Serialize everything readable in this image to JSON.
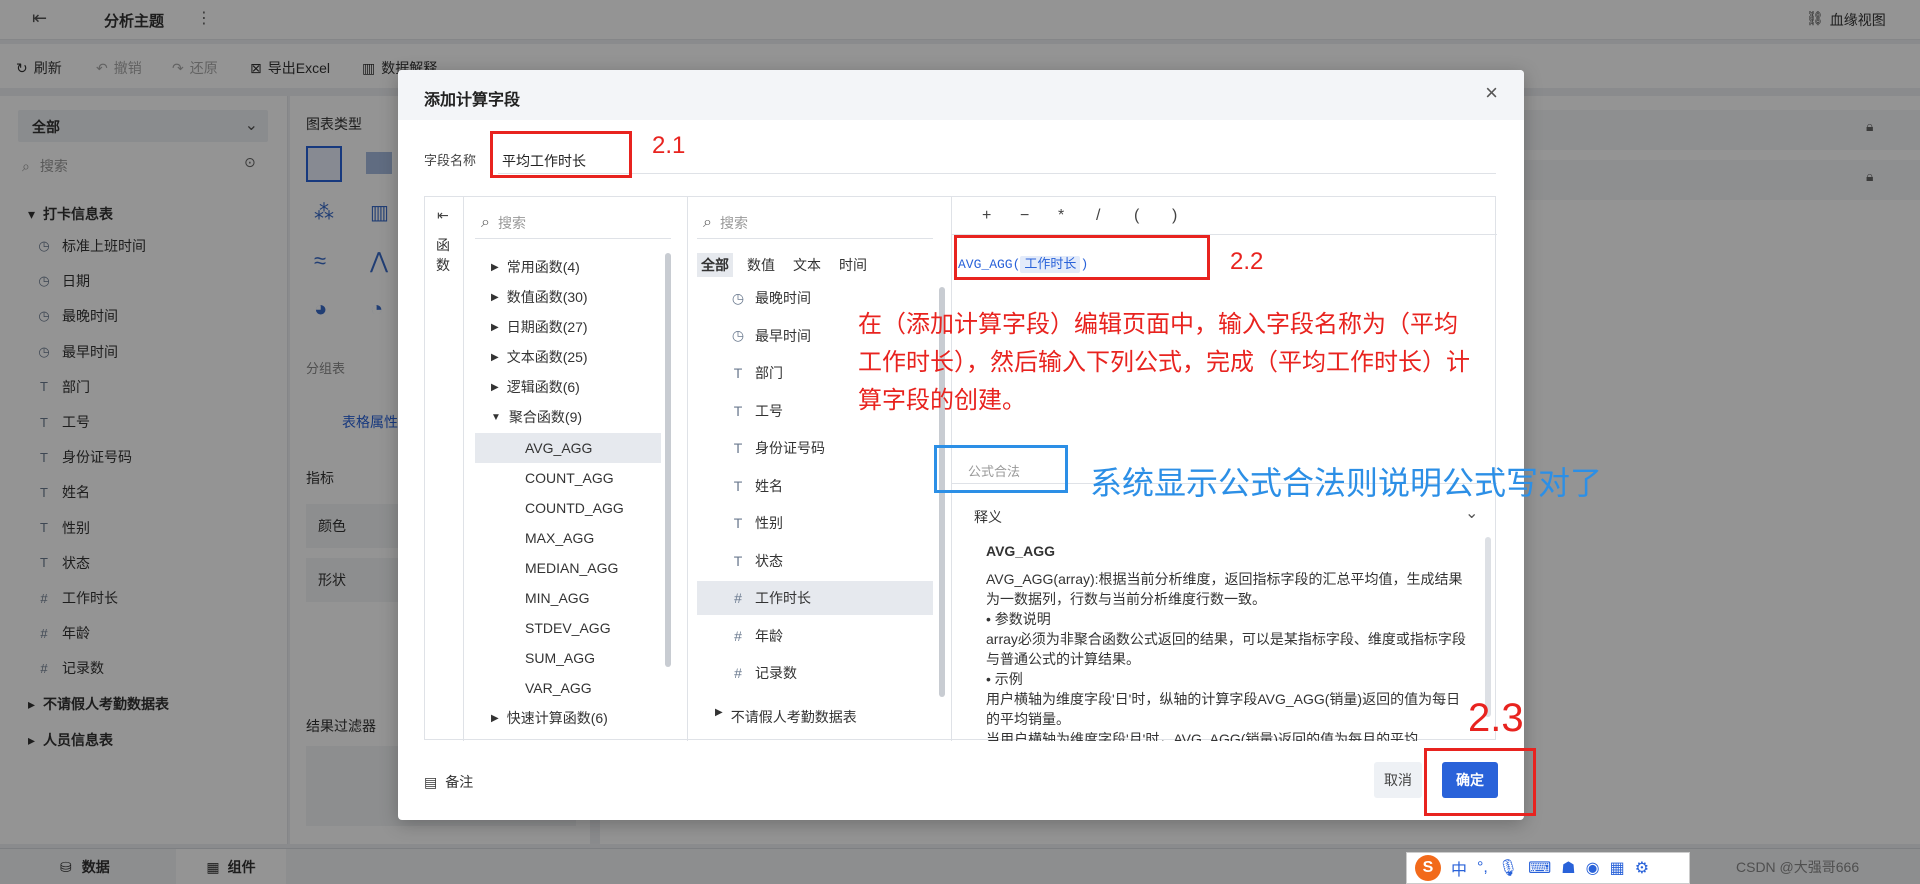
{
  "app": {
    "title": "分析主题",
    "lineage_label": "血缘视图",
    "toolbar": [
      {
        "label": "刷新",
        "disabled": false
      },
      {
        "label": "撤销",
        "disabled": true
      },
      {
        "label": "还原",
        "disabled": true
      },
      {
        "label": "导出Excel",
        "disabled": false
      },
      {
        "label": "数据解释",
        "disabled": false
      }
    ],
    "left": {
      "select_value": "全部",
      "search_placeholder": "搜索",
      "table1": "打卡信息表",
      "fields": [
        {
          "icon": "clock",
          "name": "标准上班时间"
        },
        {
          "icon": "clock",
          "name": "日期"
        },
        {
          "icon": "clock",
          "name": "最晚时间"
        },
        {
          "icon": "clock",
          "name": "最早时间"
        },
        {
          "icon": "text",
          "name": "部门"
        },
        {
          "icon": "text",
          "name": "工号"
        },
        {
          "icon": "text",
          "name": "身份证号码"
        },
        {
          "icon": "text",
          "name": "姓名"
        },
        {
          "icon": "text",
          "name": "性别"
        },
        {
          "icon": "text",
          "name": "状态"
        },
        {
          "icon": "number",
          "name": "工作时长"
        },
        {
          "icon": "number",
          "name": "年龄"
        },
        {
          "icon": "number",
          "name": "记录数"
        }
      ],
      "table2": "不请假人考勤数据表",
      "table3": "人员信息表"
    },
    "middle": {
      "chart_type": "图表类型",
      "group_table": "分组表",
      "table_attr": "表格属性",
      "indicator": "指标",
      "color": "颜色",
      "shape": "形状",
      "result_filter": "结果过滤器"
    },
    "bottom": {
      "data_tab": "数据",
      "component_tab": "组件",
      "watermark": "CSDN @大强哥666"
    }
  },
  "dialog": {
    "title": "添加计算字段",
    "field_name_label": "字段名称",
    "field_name_value": "平均工作时长",
    "func_tab": "函数",
    "func_search_placeholder": "搜索",
    "categories": [
      {
        "label": "常用函数(4)",
        "expanded": false
      },
      {
        "label": "数值函数(30)",
        "expanded": false
      },
      {
        "label": "日期函数(27)",
        "expanded": false
      },
      {
        "label": "文本函数(25)",
        "expanded": false
      },
      {
        "label": "逻辑函数(6)",
        "expanded": false
      },
      {
        "label": "聚合函数(9)",
        "expanded": true
      }
    ],
    "agg_functions": [
      "AVG_AGG",
      "COUNT_AGG",
      "COUNTD_AGG",
      "MAX_AGG",
      "MEDIAN_AGG",
      "MIN_AGG",
      "STDEV_AGG",
      "SUM_AGG",
      "VAR_AGG"
    ],
    "quick_calc": "快速计算函数(6)",
    "field_search_placeholder": "搜索",
    "field_tabs": [
      "全部",
      "数值",
      "文本",
      "时间"
    ],
    "field_list": [
      {
        "icon": "clock",
        "name": "最晚时间"
      },
      {
        "icon": "clock",
        "name": "最早时间"
      },
      {
        "icon": "text",
        "name": "部门"
      },
      {
        "icon": "text",
        "name": "工号"
      },
      {
        "icon": "text",
        "name": "身份证号码"
      },
      {
        "icon": "text",
        "name": "姓名"
      },
      {
        "icon": "text",
        "name": "性别"
      },
      {
        "icon": "text",
        "name": "状态"
      },
      {
        "icon": "number",
        "name": "工作时长"
      },
      {
        "icon": "number",
        "name": "年龄"
      },
      {
        "icon": "number",
        "name": "记录数"
      }
    ],
    "field_group_bottom": "不请假人考勤数据表",
    "operators": [
      "+",
      "−",
      "*",
      "/",
      "(",
      ")"
    ],
    "formula_func": "AVG_AGG(",
    "formula_field": "工作时长",
    "formula_close": ")",
    "valid_label": "公式合法",
    "explain_label": "释义",
    "explain_title": "AVG_AGG",
    "explain_lines": [
      "AVG_AGG(array):根据当前分析维度，返回指标字段的汇总平均值，生成结果为一数据列，行数与当前分析维度行数一致。",
      "• 参数说明",
      "array必须为非聚合函数公式返回的结果，可以是某指标字段、维度或指标字段与普通公式的计算结果。",
      "• 示例",
      "用户横轴为维度字段'日'时，纵轴的计算字段AVG_AGG(销量)返回的值为每日的平均销量。",
      "当用户横轴为维度字段'月'时，AVG_AGG(销量)返回的值为每月的平均"
    ],
    "note_label": "备注",
    "cancel_label": "取消",
    "ok_label": "确定"
  },
  "annotations": {
    "a21": "2.1",
    "a22": "2.2",
    "a23": "2.3",
    "instruction": "在（添加计算字段）编辑页面中，输入字段名称为（平均工作时长），然后输入下列公式，完成（平均工作时长）计算字段的创建。",
    "valid_note": "系统显示公式合法则说明公式写对了"
  },
  "colors": {
    "accent": "#2962d9",
    "annotation_red": "#e8231f",
    "annotation_blue": "#2c8fe6"
  }
}
